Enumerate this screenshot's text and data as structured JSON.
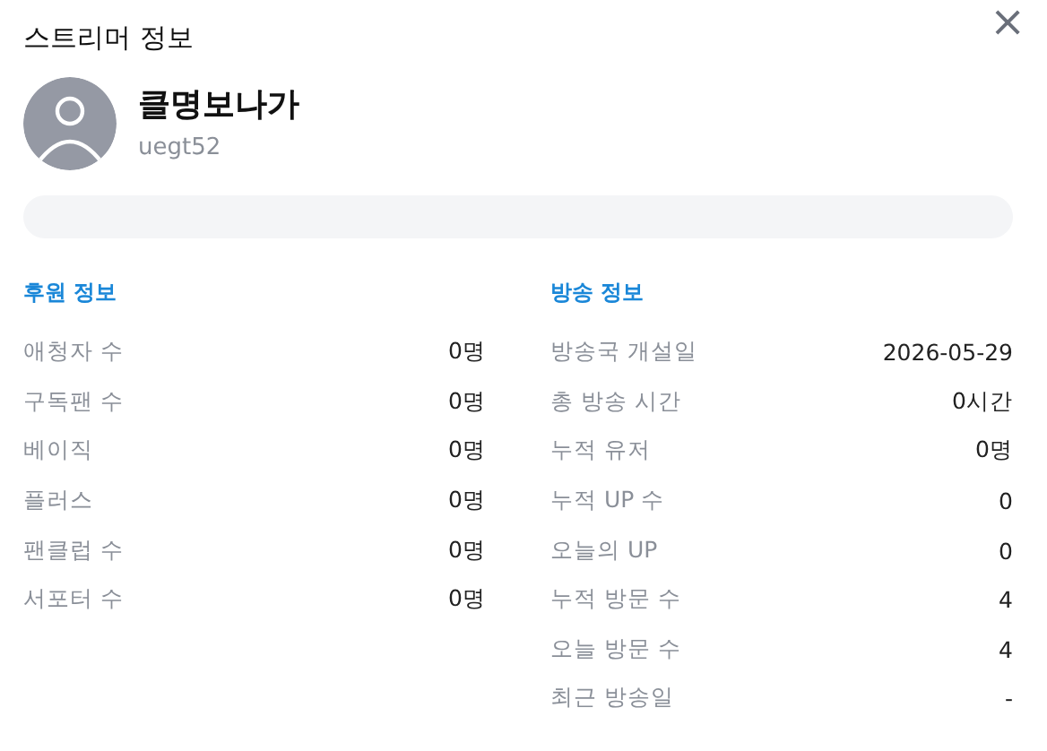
{
  "dialog": {
    "title": "스트리머 정보",
    "close": "×"
  },
  "profile": {
    "name": "클명보나가",
    "user_id": "uegt52"
  },
  "sections": [
    {
      "title": "후원 정보",
      "rows": [
        {
          "label": "애청자 수",
          "value": "0명"
        },
        {
          "label": "구독팬 수",
          "value": "0명"
        },
        {
          "label": "베이직",
          "value": "0명"
        },
        {
          "label": "플러스",
          "value": "0명"
        },
        {
          "label": "팬클럽 수",
          "value": "0명"
        },
        {
          "label": "서포터 수",
          "value": "0명"
        }
      ]
    },
    {
      "title": "방송 정보",
      "rows": [
        {
          "label": "방송국 개설일",
          "value": "2026-05-29"
        },
        {
          "label": "총 방송 시간",
          "value": "0시간"
        },
        {
          "label": "누적 유저",
          "value": "0명"
        },
        {
          "label": "누적 UP 수",
          "value": "0"
        },
        {
          "label": "오늘의 UP",
          "value": "0"
        },
        {
          "label": "누적 방문 수",
          "value": "4"
        },
        {
          "label": "오늘 방문 수",
          "value": "4"
        },
        {
          "label": "최근 방송일",
          "value": "-"
        }
      ]
    }
  ]
}
